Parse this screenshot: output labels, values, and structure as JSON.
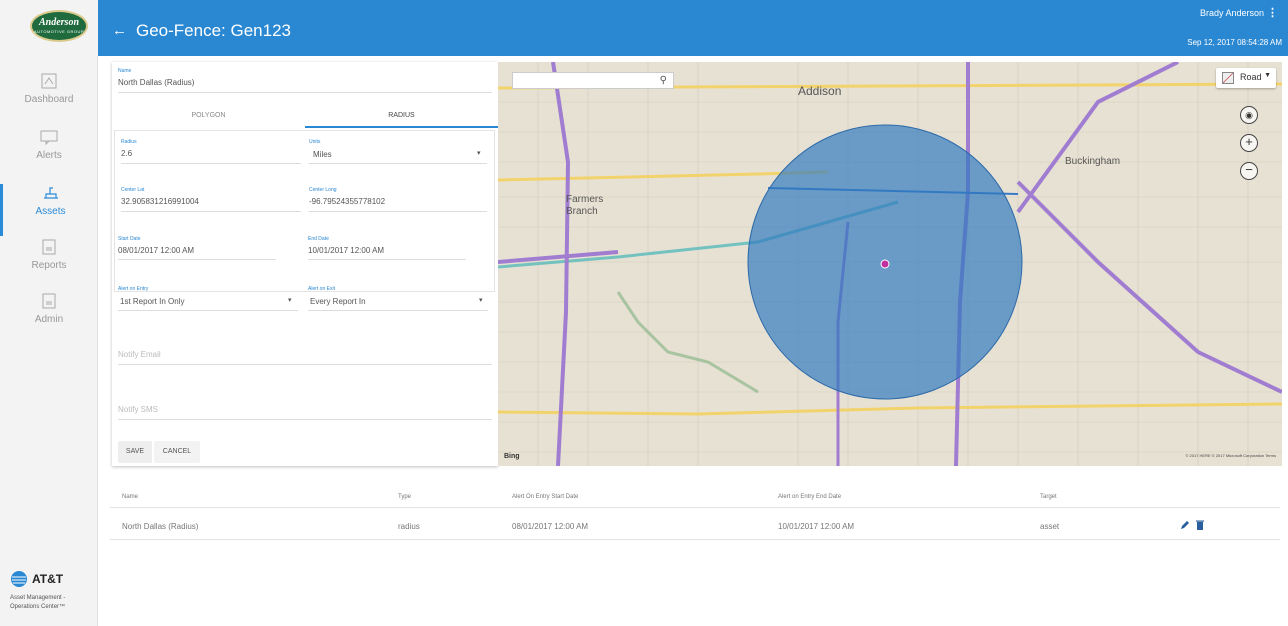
{
  "header": {
    "title": "Geo-Fence: Gen123",
    "user": "Brady Anderson",
    "datetime": "Sep 12, 2017 08:54:28 AM",
    "bg_color": "#2a88d3"
  },
  "logo": {
    "title": "Anderson",
    "subtitle": "AUTOMOTIVE GROUP"
  },
  "sidebar": {
    "items": [
      {
        "label": "Dashboard",
        "icon": "dashboard-icon",
        "active": false
      },
      {
        "label": "Alerts",
        "icon": "alerts-icon",
        "active": false
      },
      {
        "label": "Assets",
        "icon": "assets-icon",
        "active": true
      },
      {
        "label": "Reports",
        "icon": "reports-icon",
        "active": false
      },
      {
        "label": "Admin",
        "icon": "admin-icon",
        "active": false
      }
    ],
    "brand": "AT&T",
    "brand_sub_1": "Asset Management -",
    "brand_sub_2": "Operations Center™"
  },
  "form": {
    "name_label": "Name",
    "name_value": "North Dallas (Radius)",
    "tab_polygon": "POLYGON",
    "tab_radius": "RADIUS",
    "radius_label": "Radius",
    "radius_value": "2.6",
    "units_label": "Units",
    "units_value": "Miles",
    "center_lat_label": "Center Lat",
    "center_lat_value": "32.905831216991004",
    "center_long_label": "Center Long",
    "center_long_value": "-96.79524355778102",
    "start_date_label": "Start Date",
    "start_date_value": "08/01/2017 12:00 AM",
    "end_date_label": "End Date",
    "end_date_value": "10/01/2017 12:00 AM",
    "alert_entry_label": "Alert on Entry",
    "alert_entry_value": "1st Report In Only",
    "alert_exit_label": "Alert on Exit",
    "alert_exit_value": "Every Report In",
    "notify_email_placeholder": "Notify Email",
    "notify_sms_placeholder": "Notify SMS",
    "save_label": "SAVE",
    "cancel_label": "CANCEL"
  },
  "map": {
    "search_placeholder": "",
    "layer_label": "Road",
    "places": [
      "Addison",
      "Farmers Branch",
      "Buckingham"
    ],
    "bing": "Bing",
    "copyright": "© 2017 HERE © 2017 Microsoft Corporation  Terms",
    "fence_color": "#2f79c0"
  },
  "table": {
    "headers": [
      "Name",
      "Type",
      "Alert On Entry Start Date",
      "Alert on Entry End Date",
      "Target"
    ],
    "rows": [
      [
        "North Dallas (Radius)",
        "radius",
        "08/01/2017 12:00 AM",
        "10/01/2017 12:00 AM",
        "asset"
      ]
    ]
  }
}
